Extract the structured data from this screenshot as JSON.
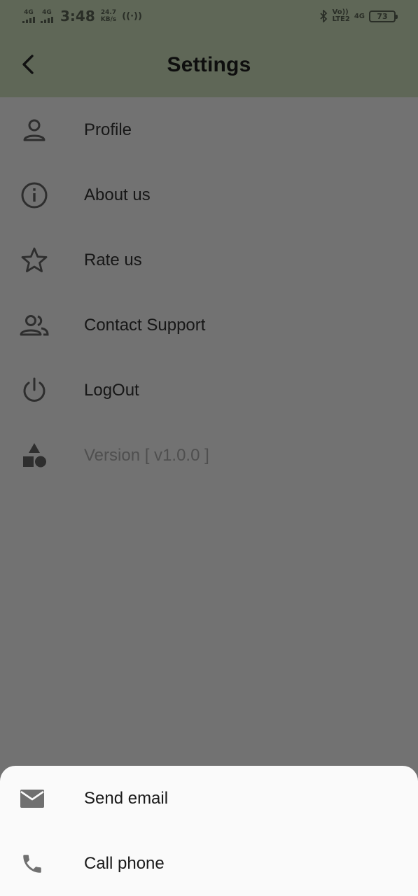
{
  "status_bar": {
    "sim1": "4G",
    "sim2": "4G",
    "time": "3:48",
    "speed_value": "24.7",
    "speed_unit": "KB/s",
    "volte_top": "Vo))",
    "volte_bottom": "LTE2",
    "net_type": "4G",
    "battery": "73"
  },
  "header": {
    "title": "Settings",
    "back_icon": "chevron-left-icon"
  },
  "menu": {
    "items": [
      {
        "label": "Profile",
        "icon": "person-icon"
      },
      {
        "label": "About us",
        "icon": "info-icon"
      },
      {
        "label": "Rate us",
        "icon": "star-icon"
      },
      {
        "label": "Contact Support",
        "icon": "people-icon"
      },
      {
        "label": "LogOut",
        "icon": "power-icon"
      },
      {
        "label": "Version [ v1.0.0 ]",
        "icon": "shapes-icon"
      }
    ]
  },
  "sheet": {
    "items": [
      {
        "label": "Send email",
        "icon": "mail-icon"
      },
      {
        "label": "Call phone",
        "icon": "phone-icon"
      }
    ]
  },
  "colors": {
    "appbar": "#5f6757",
    "scrim_background": "#727272",
    "sheet_background": "#fafafa",
    "icon_dark": "#2e2e2e"
  }
}
